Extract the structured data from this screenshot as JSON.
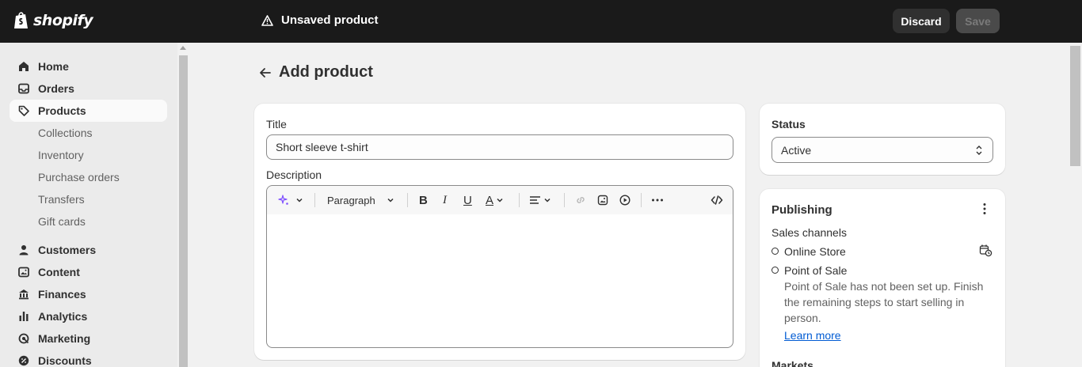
{
  "topbar": {
    "brand": "shopify",
    "unsaved_label": "Unsaved product",
    "discard_label": "Discard",
    "save_label": "Save"
  },
  "sidebar": {
    "items": [
      {
        "label": "Home",
        "icon": "home-icon"
      },
      {
        "label": "Orders",
        "icon": "inbox-icon"
      },
      {
        "label": "Products",
        "icon": "tag-icon",
        "active": true
      },
      {
        "label": "Customers",
        "icon": "person-icon"
      },
      {
        "label": "Content",
        "icon": "image-icon"
      },
      {
        "label": "Finances",
        "icon": "bank-icon"
      },
      {
        "label": "Analytics",
        "icon": "bar-chart-icon"
      },
      {
        "label": "Marketing",
        "icon": "target-icon"
      },
      {
        "label": "Discounts",
        "icon": "discount-icon"
      }
    ],
    "product_subitems": [
      "Collections",
      "Inventory",
      "Purchase orders",
      "Transfers",
      "Gift cards"
    ]
  },
  "page": {
    "title": "Add product"
  },
  "product_card": {
    "title_label": "Title",
    "title_value": "Short sleeve t-shirt",
    "description_label": "Description",
    "toolbar": {
      "paragraph_label": "Paragraph",
      "bold": "B",
      "italic": "I",
      "underline": "U",
      "text_color": "A"
    }
  },
  "status_card": {
    "title": "Status",
    "value": "Active"
  },
  "publishing_card": {
    "title": "Publishing",
    "sales_channels_label": "Sales channels",
    "channels": [
      "Online Store",
      "Point of Sale"
    ],
    "pos_note": "Point of Sale has not been set up. Finish the remaining steps to start selling in person.",
    "learn_more": "Learn more",
    "markets_label": "Markets"
  },
  "colors": {
    "topbar": "#1a1a1a",
    "accent_link": "#005bd3",
    "magic": "#8051ff"
  }
}
